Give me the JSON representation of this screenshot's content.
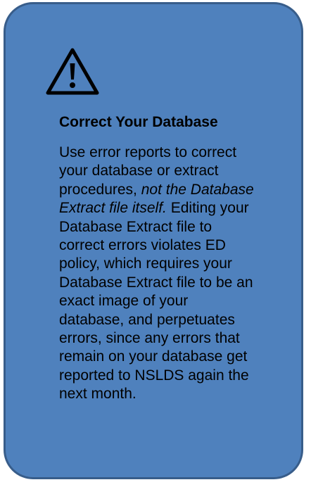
{
  "callout": {
    "icon": "warning-triangle-icon",
    "fill_color": "#4f81bd",
    "border_color": "#385d8a",
    "heading": "Correct Your Database",
    "body_lines": [
      [
        {
          "text": "Use error reports to correct"
        }
      ],
      [
        {
          "text": "your database or extract"
        }
      ],
      [
        {
          "text": "procedures, "
        },
        {
          "text": "not the Database",
          "italic": true
        }
      ],
      [
        {
          "text": "Extract file itself.",
          "italic": true
        },
        {
          "text": " Editing your"
        }
      ],
      [
        {
          "text": "Database Extract file to"
        }
      ],
      [
        {
          "text": "correct errors violates ED"
        }
      ],
      [
        {
          "text": "policy, which requires your"
        }
      ],
      [
        {
          "text": "Database Extract file to be an"
        }
      ],
      [
        {
          "text": "exact image of your"
        }
      ],
      [
        {
          "text": "database, and perpetuates"
        }
      ],
      [
        {
          "text": "errors, since any errors that"
        }
      ],
      [
        {
          "text": "remain on your database get"
        }
      ],
      [
        {
          "text": "reported to NSLDS again the"
        }
      ],
      [
        {
          "text": "next month."
        }
      ]
    ]
  }
}
